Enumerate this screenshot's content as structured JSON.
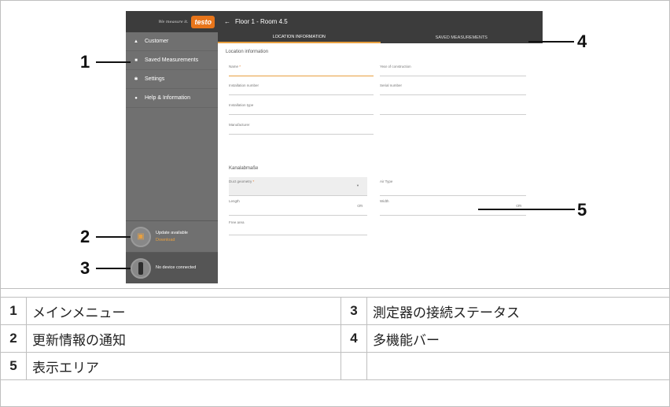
{
  "app": {
    "brand_tagline": "We measure it.",
    "brand_logo": "testo",
    "title": "Floor 1 - Room 4.5",
    "tabs": [
      "LOCATION INFORMATION",
      "SAVED MEASUREMENTS"
    ],
    "menu": [
      {
        "icon": "person-icon",
        "label": "Customer"
      },
      {
        "icon": "floppy-icon",
        "label": "Saved Measurements"
      },
      {
        "icon": "gear-icon",
        "label": "Settings"
      },
      {
        "icon": "info-icon",
        "label": "Help & Information"
      }
    ],
    "update": {
      "title": "Update available",
      "action": "Download"
    },
    "device": {
      "status": "No device connected"
    },
    "section_location": "Location information",
    "section_duct": "Kanalabmaße",
    "fields": {
      "name": "Name",
      "year": "Year of construction",
      "install_number": "Installation number",
      "serial": "Serial number",
      "install_type": "Installation type",
      "manufacturer": "Manufacturer",
      "duct_geometry": "Duct geometry",
      "air_type": "Air Type",
      "length": "Length",
      "width": "Width",
      "free_area": "Free area",
      "unit": "cm"
    }
  },
  "callouts": [
    "1",
    "2",
    "3",
    "4",
    "5"
  ],
  "legend": [
    {
      "num": "1",
      "text": "メインメニュー",
      "num2": "3",
      "text2": "測定器の接続ステータス"
    },
    {
      "num": "2",
      "text": "更新情報の通知",
      "num2": "4",
      "text2": "多機能バー"
    },
    {
      "num": "5",
      "text": "表示エリア",
      "num2": "",
      "text2": ""
    }
  ]
}
